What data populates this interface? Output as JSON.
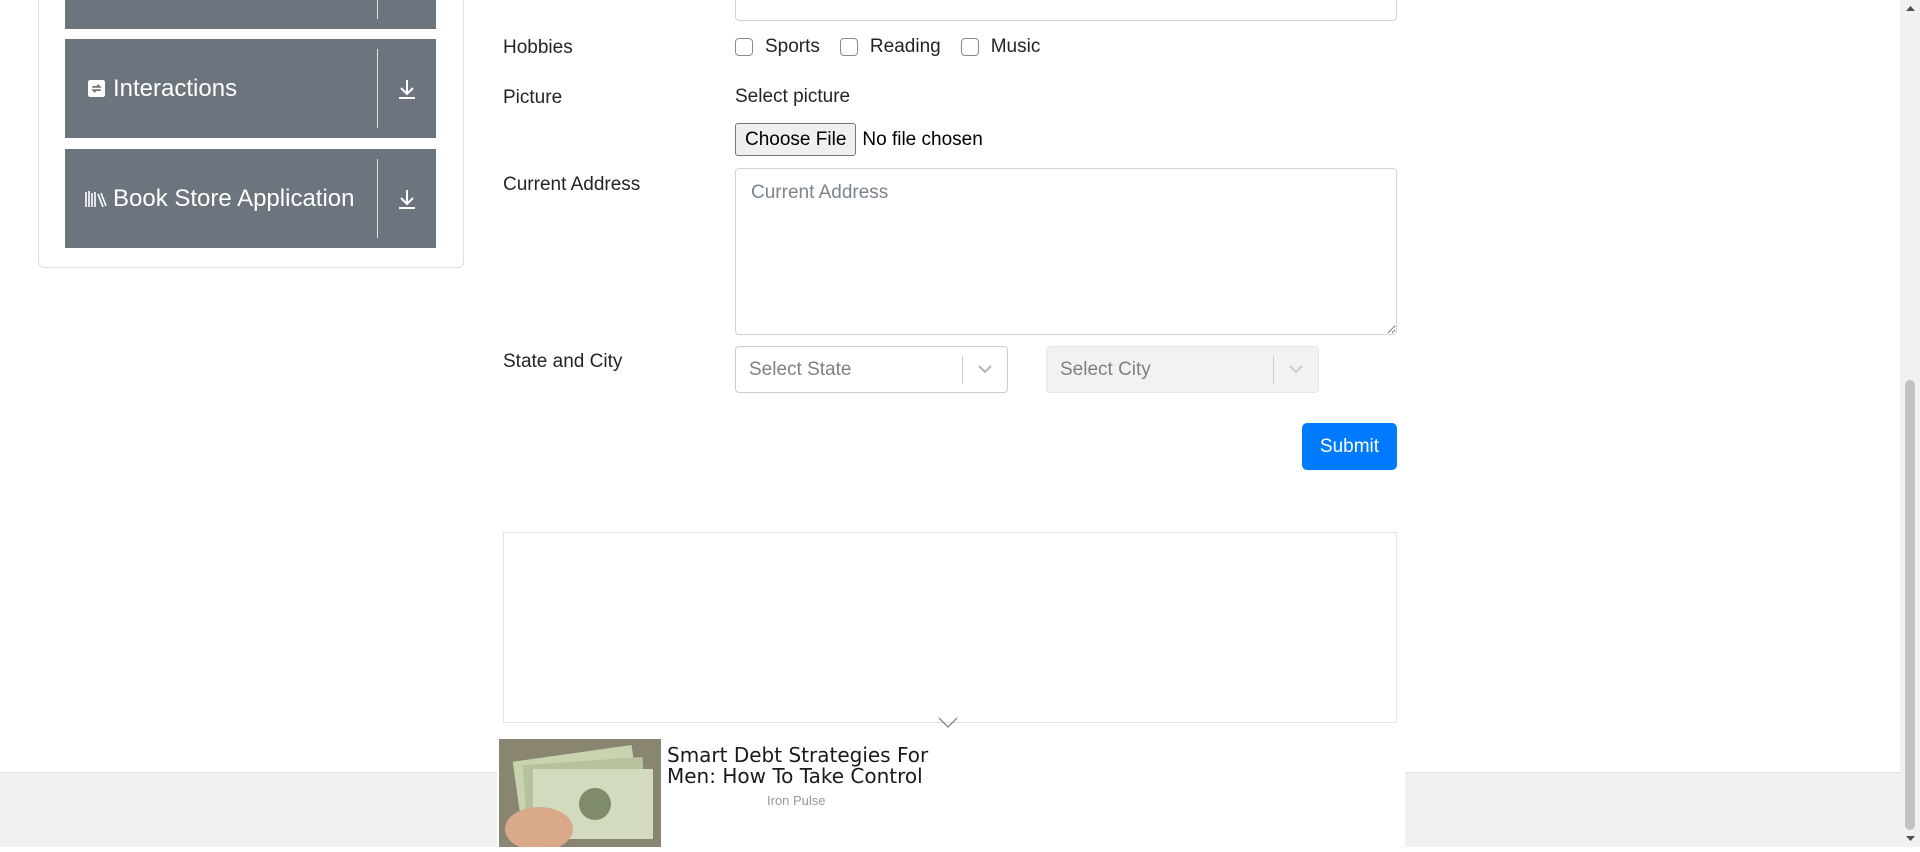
{
  "sidebar": {
    "items": [
      {
        "label": "",
        "icon": "unknown-icon"
      },
      {
        "label": "Interactions",
        "icon": "refresh-icon"
      },
      {
        "label": "Book Store Application",
        "icon": "books-icon"
      }
    ]
  },
  "form": {
    "hobbies": {
      "label": "Hobbies",
      "options": [
        "Sports",
        "Reading",
        "Music"
      ]
    },
    "picture": {
      "label": "Picture",
      "caption": "Select picture",
      "button_label": "Choose File",
      "status": "No file chosen"
    },
    "address": {
      "label": "Current Address",
      "placeholder": "Current Address",
      "value": ""
    },
    "state_city": {
      "label": "State and City",
      "state_placeholder": "Select State",
      "city_placeholder": "Select City"
    },
    "submit_label": "Submit"
  },
  "ad": {
    "title": "Smart Debt Strategies For Men: How To Take Control",
    "source": "Iron Pulse"
  },
  "colors": {
    "sidebar_item_bg": "#6c757d",
    "primary": "#007bff"
  }
}
